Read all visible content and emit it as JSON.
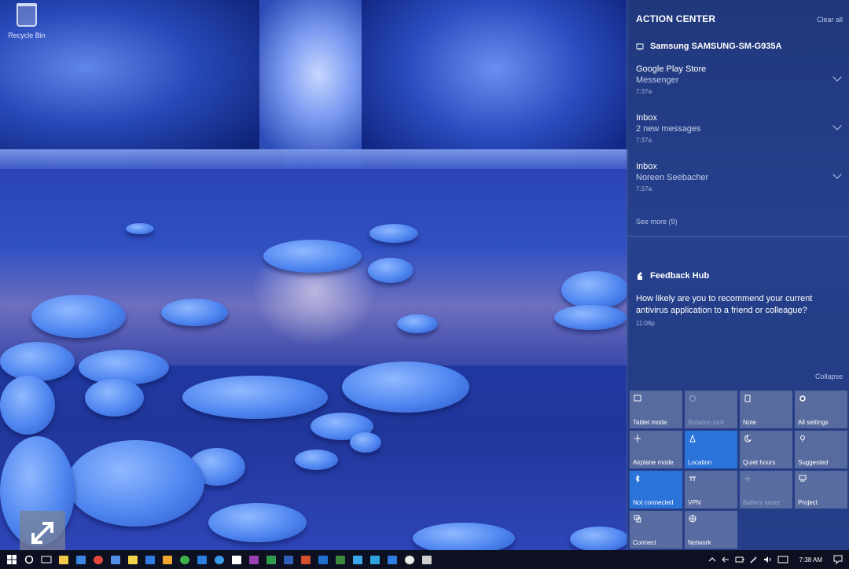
{
  "desktop": {
    "recycle_bin_label": "Recycle Bin"
  },
  "action_center": {
    "title": "ACTION CENTER",
    "clear_all": "Clear all",
    "device_name": "Samsung SAMSUNG-SM-G935A",
    "notifications": [
      {
        "title": "Google Play Store",
        "body": "Messenger",
        "time": "7:37a"
      },
      {
        "title": "Inbox",
        "body": "2 new messages",
        "time": "7:37a"
      },
      {
        "title": "Inbox",
        "body": "Noreen Seebacher",
        "time": "7:37a"
      }
    ],
    "see_more": "See more (9)",
    "feedback": {
      "app": "Feedback Hub",
      "body": "How likely are you to recommend your current antivirus application to a friend or colleague?",
      "time": "11:06p"
    },
    "collapse": "Collapse",
    "quick_actions": [
      {
        "label": "Tablet mode",
        "icon": "tablet-icon",
        "state": "off"
      },
      {
        "label": "Rotation lock",
        "icon": "rotation-lock-icon",
        "state": "disabled"
      },
      {
        "label": "Note",
        "icon": "note-icon",
        "state": "off"
      },
      {
        "label": "All settings",
        "icon": "gear-icon",
        "state": "off"
      },
      {
        "label": "Airplane mode",
        "icon": "airplane-icon",
        "state": "off"
      },
      {
        "label": "Location",
        "icon": "location-icon",
        "state": "on"
      },
      {
        "label": "Quiet hours",
        "icon": "moon-icon",
        "state": "off"
      },
      {
        "label": "Suggested",
        "icon": "bulb-icon",
        "state": "off"
      },
      {
        "label": "Not connected",
        "icon": "bluetooth-icon",
        "state": "on"
      },
      {
        "label": "VPN",
        "icon": "vpn-icon",
        "state": "off"
      },
      {
        "label": "Battery saver",
        "icon": "battery-saver-icon",
        "state": "disabled"
      },
      {
        "label": "Project",
        "icon": "project-icon",
        "state": "off"
      },
      {
        "label": "Connect",
        "icon": "connect-icon",
        "state": "off"
      },
      {
        "label": "Network",
        "icon": "globe-icon",
        "state": "off"
      }
    ]
  },
  "taskbar": {
    "pinned_apps": [
      {
        "name": "file-explorer",
        "color": "#f3c64a"
      },
      {
        "name": "store",
        "color": "#3a86e0"
      },
      {
        "name": "chrome",
        "color": "#e24a3b"
      },
      {
        "name": "onedrive",
        "color": "#4f8fe8"
      },
      {
        "name": "sticky-notes",
        "color": "#f1d24a"
      },
      {
        "name": "calendar",
        "color": "#2f7de0"
      },
      {
        "name": "headphones",
        "color": "#f0a530"
      },
      {
        "name": "xbox",
        "color": "#3bb34a"
      },
      {
        "name": "photos",
        "color": "#2f7de0"
      },
      {
        "name": "edge",
        "color": "#3a9be8"
      },
      {
        "name": "folder",
        "color": "#ffffff"
      },
      {
        "name": "onenote",
        "color": "#9b3fb5"
      },
      {
        "name": "excel",
        "color": "#2e9d4f"
      },
      {
        "name": "word",
        "color": "#2f5fb8"
      },
      {
        "name": "powerpoint",
        "color": "#d2502a"
      },
      {
        "name": "outlook",
        "color": "#1e6fd0"
      },
      {
        "name": "project",
        "color": "#3a8a3a"
      },
      {
        "name": "twitter",
        "color": "#3aa7e8"
      },
      {
        "name": "skype",
        "color": "#2ea3e0"
      },
      {
        "name": "mail",
        "color": "#2f7de0"
      },
      {
        "name": "paint",
        "color": "#e8e8e8"
      },
      {
        "name": "settings",
        "color": "#cfcfcf"
      }
    ],
    "clock": "7:38 AM"
  }
}
